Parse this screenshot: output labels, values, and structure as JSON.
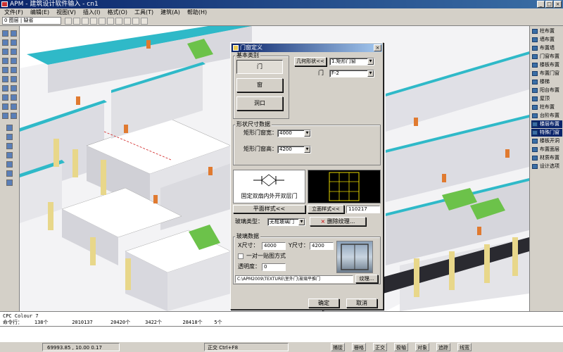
{
  "window": {
    "title": "APM - 建筑设计软件输入 - cn1",
    "controls": [
      "_",
      "□",
      "×"
    ]
  },
  "menu": [
    "文件(F)",
    "编辑(E)",
    "视图(V)",
    "插入(I)",
    "格式(O)",
    "工具(T)",
    "建筑(A)",
    "帮助(H)"
  ],
  "toolbar": {
    "layer_select": "0 图层 | 缺省"
  },
  "dialog": {
    "title": "门窗定义",
    "close": "×",
    "basic_group": "基本类别",
    "type_buttons": [
      "门",
      "窗",
      "洞口"
    ],
    "geometry_button": "几何形状<<",
    "shape_value": "1.矩形门窗",
    "shape_label": "门",
    "type_value": "F-2",
    "size_group": "形状尺寸数据",
    "width_label": "矩形门窗宽：",
    "width_value": "4000",
    "height_label": "矩形门窗高：",
    "height_value": "4200",
    "preview_caption": "固定双扇内外开双层门",
    "plan_style_button": "平面样式<<",
    "elevation_style_button": "立面样式<<",
    "elevation_code": "110217",
    "glass_type_label": "玻璃类型：",
    "glass_type_value": "无框玻璃门",
    "delete_texture_button": "删除纹理...",
    "delete_icon": "×",
    "glass_group": "玻璃数据",
    "x_size_label": "X尺寸：",
    "x_size_value": "4000",
    "y_size_label": "Y尺寸：",
    "y_size_value": "4200",
    "tile_label": "一对一贴图方式",
    "transparency_label": "透明度：",
    "transparency_value": "0",
    "texture_path": "C:\\APM2009\\TEXTURE\\室外门\\玻璃平推门",
    "texture_button": "纹理...",
    "ok_button": "确定",
    "cancel_button": "取消"
  },
  "right_panel": {
    "items": [
      "柱布置",
      "墙布置",
      "布置墙",
      "门窗布置",
      "楼板布置",
      "布置门窗",
      "楼梯",
      "阳台布置",
      "屋顶",
      "柱布置",
      "台阶布置",
      "楼层布置",
      "特殊门窗",
      "楼板开洞",
      "布置面层",
      "材质布置",
      "设计选项"
    ],
    "highlighted": [
      11,
      12
    ]
  },
  "command": {
    "lines": [
      "CPC Colour 7",
      "命令行：    138个        2010137      20420个     3422个       28418个    5个"
    ]
  },
  "status": {
    "coords": "69993.85 ,  10.00   0.17",
    "extra": "正交 Ctrl+F8",
    "toggles": [
      "捕捉",
      "栅格",
      "正交",
      "极轴",
      "对象",
      "追踪",
      "线宽"
    ]
  },
  "colors": {
    "title_bar": "#0a246a",
    "wall_top": "#2fb9c8",
    "wall": "#e2e2e6",
    "column": "#e8d78a",
    "door": "#e07a30",
    "stair": "#6cc24a",
    "floor": "#f6f6f8",
    "preview_bg": "#000000",
    "preview_line": "#e8d800"
  }
}
